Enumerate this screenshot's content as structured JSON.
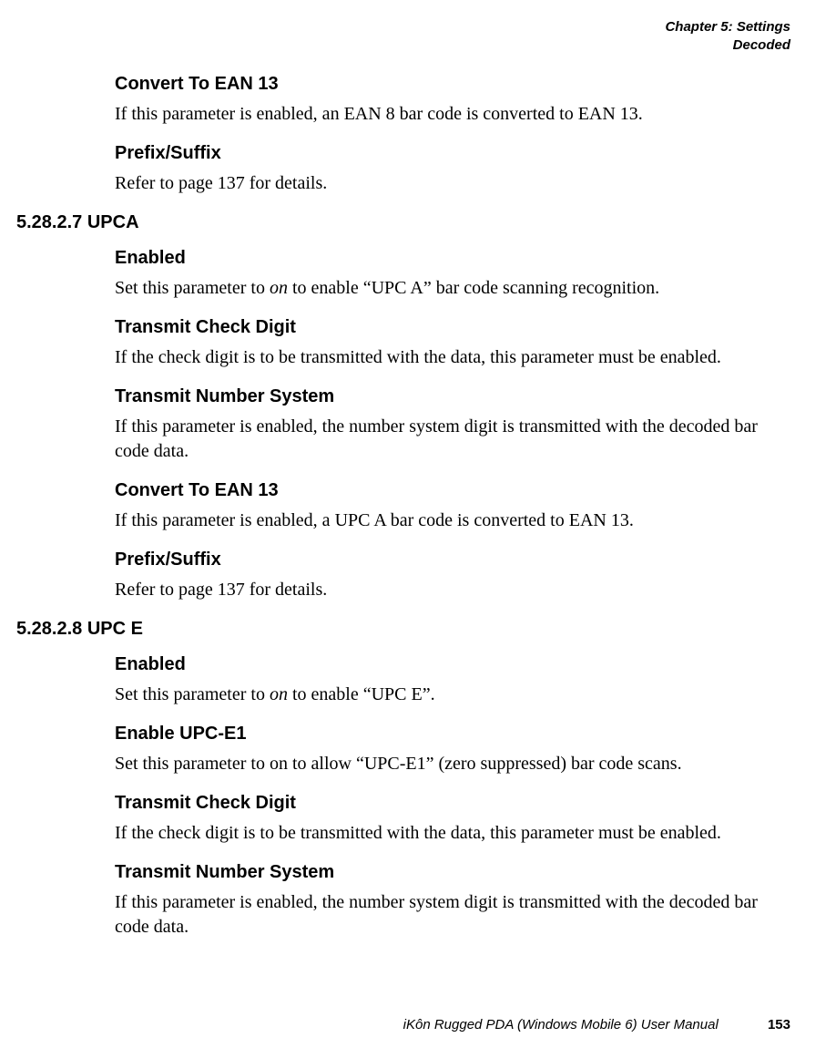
{
  "header": {
    "line1": "Chapter 5:  Settings",
    "line2": "Decoded"
  },
  "sections": {
    "s0": {
      "h1": "Convert To EAN 13",
      "p1": "If this parameter is enabled, an EAN 8 bar code is converted to EAN 13.",
      "h2": "Prefix/Suffix",
      "p2": "Refer to page 137 for details."
    },
    "s1": {
      "num": "5.28.2.7",
      "title": "UPCA",
      "h1": "Enabled",
      "p1a": "Set this parameter to ",
      "p1i": "on",
      "p1b": " to enable “UPC A” bar code scanning recognition.",
      "h2": "Transmit Check Digit",
      "p2": "If the check digit is to be transmitted with the data, this parameter must be enabled.",
      "h3": "Transmit Number System",
      "p3": "If this parameter is enabled, the number system digit is transmitted with the decoded bar code data.",
      "h4": "Convert To EAN 13",
      "p4": "If this parameter is enabled, a UPC A bar code is converted to EAN 13.",
      "h5": "Prefix/Suffix",
      "p5": "Refer to page 137 for details."
    },
    "s2": {
      "num": "5.28.2.8",
      "title": "UPC E",
      "h1": "Enabled",
      "p1a": "Set this parameter to ",
      "p1i": "on",
      "p1b": " to enable “UPC E”.",
      "h2": "Enable UPC-E1",
      "p2": "Set this parameter to on to allow “UPC-E1” (zero suppressed) bar code scans.",
      "h3": "Transmit Check Digit",
      "p3": "If the check digit is to be transmitted with the data, this parameter must be enabled.",
      "h4": "Transmit Number System",
      "p4": "If this parameter is enabled, the number system digit is transmitted with the decoded bar code data."
    }
  },
  "footer": {
    "text": "iKôn Rugged PDA (Windows Mobile 6) User Manual",
    "page": "153"
  }
}
